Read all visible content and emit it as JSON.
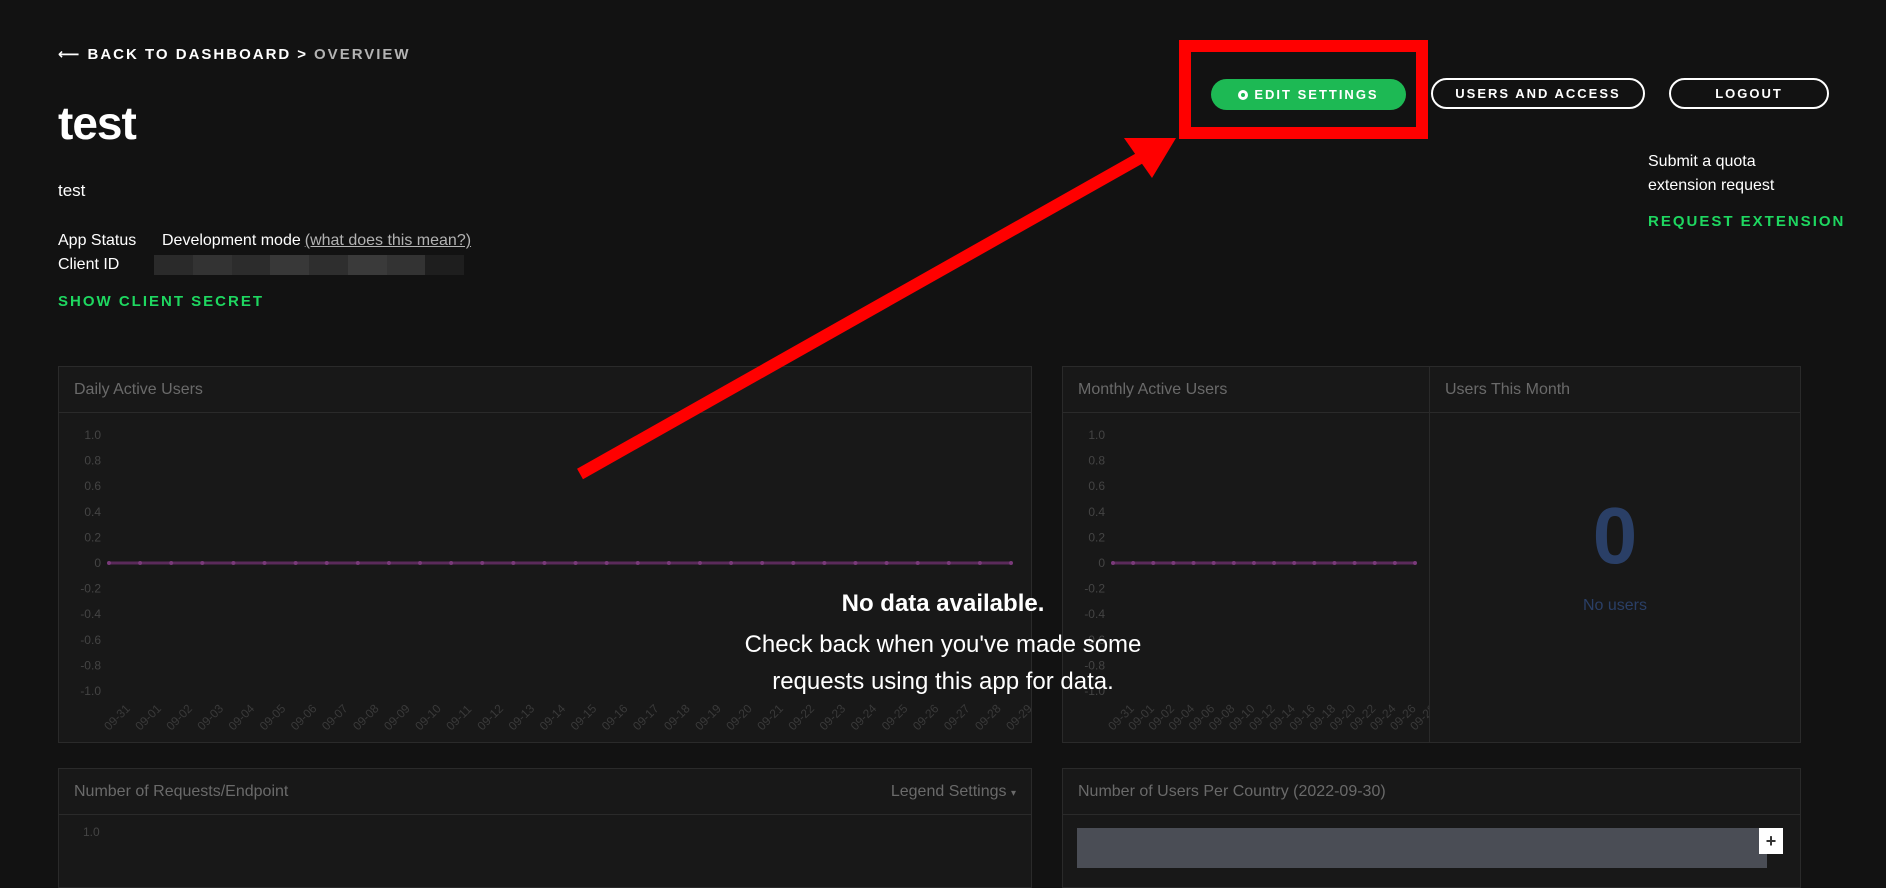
{
  "breadcrumb": {
    "back": "BACK TO DASHBOARD",
    "separator": ">",
    "current": "OVERVIEW"
  },
  "app": {
    "name": "test",
    "description": "test",
    "status_label": "App Status",
    "status_value": "Development mode",
    "status_help": "(what does this mean?)",
    "client_id_label": "Client ID",
    "show_secret": "SHOW CLIENT SECRET"
  },
  "actions": {
    "edit_settings": "EDIT SETTINGS",
    "users_access": "USERS AND ACCESS",
    "logout": "LOGOUT"
  },
  "quota": {
    "text": "Submit a quota extension request",
    "link": "REQUEST EXTENSION"
  },
  "panels": {
    "daily": "Daily Active Users",
    "monthly": "Monthly Active Users",
    "users_month": "Users This Month",
    "requests": "Number of Requests/Endpoint",
    "legend_settings": "Legend Settings",
    "country": "Number of Users Per Country (2022-09-30)"
  },
  "users_month": {
    "count": "0",
    "label": "No users"
  },
  "empty": {
    "heading": "No data available.",
    "body": "Check back when you've made some requests using this app for data."
  },
  "colors": {
    "accent": "#1db954",
    "annotation": "#ff0000",
    "series": "#5a2a5a"
  },
  "chart_data": [
    {
      "type": "line",
      "title": "Daily Active Users",
      "x": [
        "09-31",
        "09-01",
        "09-02",
        "09-03",
        "09-04",
        "09-05",
        "09-06",
        "09-07",
        "09-08",
        "09-09",
        "09-10",
        "09-11",
        "09-12",
        "09-13",
        "09-14",
        "09-15",
        "09-16",
        "09-17",
        "09-18",
        "09-19",
        "09-20",
        "09-21",
        "09-22",
        "09-23",
        "09-24",
        "09-25",
        "09-26",
        "09-27",
        "09-28",
        "09-29"
      ],
      "yticks": [
        "1.0",
        "0.8",
        "0.6",
        "0.4",
        "0.2",
        "0",
        "-0.2",
        "-0.4",
        "-0.6",
        "-0.8",
        "-1.0"
      ],
      "series": [
        {
          "values": [
            0,
            0,
            0,
            0,
            0,
            0,
            0,
            0,
            0,
            0,
            0,
            0,
            0,
            0,
            0,
            0,
            0,
            0,
            0,
            0,
            0,
            0,
            0,
            0,
            0,
            0,
            0,
            0,
            0,
            0
          ]
        }
      ],
      "ylim": [
        -1,
        1
      ]
    },
    {
      "type": "line",
      "title": "Monthly Active Users",
      "x": [
        "09-31",
        "09-01",
        "09-02",
        "09-04",
        "09-06",
        "09-08",
        "09-10",
        "09-12",
        "09-14",
        "09-16",
        "09-18",
        "09-20",
        "09-22",
        "09-24",
        "09-26",
        "09-28"
      ],
      "yticks": [
        "1.0",
        "0.8",
        "0.6",
        "0.4",
        "0.2",
        "0",
        "-0.2",
        "-0.4",
        "-0.6",
        "-0.8",
        "-1.0"
      ],
      "series": [
        {
          "values": [
            0,
            0,
            0,
            0,
            0,
            0,
            0,
            0,
            0,
            0,
            0,
            0,
            0,
            0,
            0,
            0
          ]
        }
      ],
      "ylim": [
        -1,
        1
      ]
    }
  ]
}
